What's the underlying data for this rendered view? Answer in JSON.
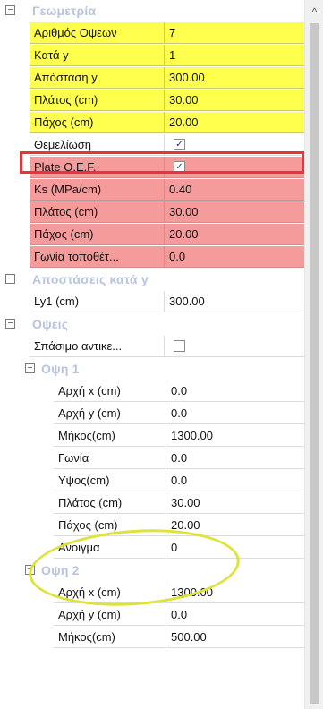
{
  "categories": {
    "geometry": "Γεωμετρία",
    "distances_y": "Αποστάσεις κατά y",
    "faces": "Οψεις",
    "face1": "Οψη 1",
    "face2": "Οψη 2"
  },
  "expander_symbol": "⊟",
  "check_symbol": "✓",
  "geometry_rows": [
    {
      "name": "Αριθμός Οψεων",
      "value": "7"
    },
    {
      "name": "Κατά y",
      "value": "1"
    },
    {
      "name": "Απόσταση y",
      "value": "300.00"
    },
    {
      "name": "Πλάτος (cm)",
      "value": "30.00"
    },
    {
      "name": "Πάχος (cm)",
      "value": "20.00"
    },
    {
      "name": "Θεμελίωση",
      "checked": true
    },
    {
      "name": "Plate O.E.F.",
      "checked": true
    },
    {
      "name": "Ks (MPa/cm)",
      "value": "0.40"
    },
    {
      "name": "Πλάτος (cm)",
      "value": "30.00"
    },
    {
      "name": "Πάχος (cm)",
      "value": "20.00"
    },
    {
      "name": "Γωνία τοποθέτ...",
      "value": "0.0"
    }
  ],
  "distances_rows": [
    {
      "name": "Ly1 (cm)",
      "value": "300.00"
    }
  ],
  "faces_rows": [
    {
      "name": "Σπάσιμο αντικε...",
      "checked": false
    }
  ],
  "face1_rows": [
    {
      "name": "Αρχή x (cm)",
      "value": "0.0"
    },
    {
      "name": "Αρχή y (cm)",
      "value": "0.0"
    },
    {
      "name": "Μήκος(cm)",
      "value": "1300.00"
    },
    {
      "name": "Γωνία",
      "value": "0.0"
    },
    {
      "name": "Υψος(cm)",
      "value": "0.0"
    },
    {
      "name": "Πλάτος (cm)",
      "value": "30.00"
    },
    {
      "name": "Πάχος (cm)",
      "value": "20.00"
    },
    {
      "name": "Ανοιγμα",
      "value": "0"
    }
  ],
  "face2_rows": [
    {
      "name": "Αρχή x (cm)",
      "value": "1300.00"
    },
    {
      "name": "Αρχή y (cm)",
      "value": "0.0"
    },
    {
      "name": "Μήκος(cm)",
      "value": "500.00"
    }
  ],
  "scroll_up_glyph": "^",
  "colors": {
    "yellow_highlight": "#ffff4d",
    "red_highlight": "#f59b9b",
    "category_text": "#b8c4de",
    "selection_border": "#e8333a",
    "annotation_ellipse": "#dde33a"
  }
}
